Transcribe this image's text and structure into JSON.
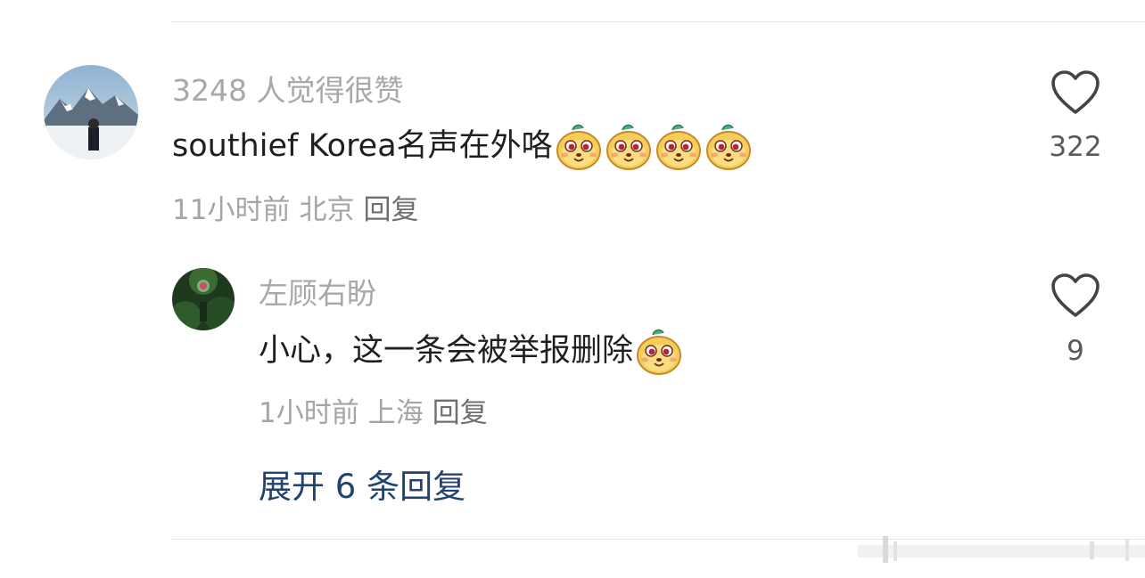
{
  "comments": [
    {
      "likes_text": "3248 人觉得很赞",
      "content": "southief Korea名声在外咯",
      "emoji_count": 4,
      "time": "11小时前",
      "location": "北京",
      "reply_label": "回复",
      "like_count": "322",
      "avatar": "avatar-snowy-mountain"
    },
    {
      "username": "左顾右盼",
      "content": "小心，这一条会被举报删除",
      "emoji_count": 1,
      "time": "1小时前",
      "location": "上海",
      "reply_label": "回复",
      "like_count": "9",
      "avatar": "avatar-green-forest"
    }
  ],
  "expand_replies": "展开 6 条回复",
  "icons": {
    "like": "heart-outline-icon",
    "emoji": "yellow-dog-emoji-icon"
  },
  "colors": {
    "primary_text": "#1f1f1f",
    "secondary_text": "#a8a8a8",
    "link": "#22436f",
    "divider": "#e6e6e6"
  }
}
